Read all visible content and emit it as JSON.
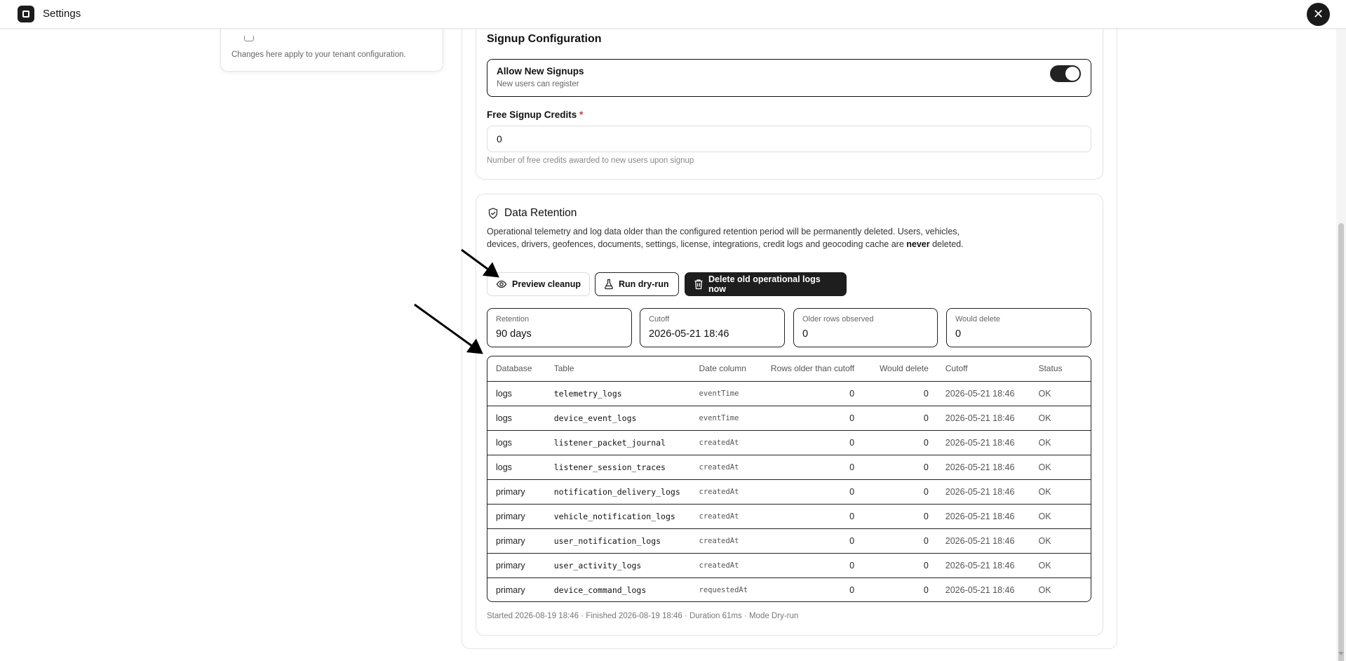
{
  "topbar": {
    "title": "Settings"
  },
  "side_card": {
    "note": "Changes here apply to your tenant configuration."
  },
  "signup": {
    "title": "Signup Configuration",
    "allow_label": "Allow New Signups",
    "allow_sub": "New users can register",
    "allow_enabled": true,
    "credits_label": "Free Signup Credits",
    "credits_required": "*",
    "credits_value": "0",
    "credits_help": "Number of free credits awarded to new users upon signup"
  },
  "retention": {
    "title": "Data Retention",
    "desc_main": "Operational telemetry and log data older than the configured retention period will be permanently deleted. Users, vehicles, devices, drivers, geofences, documents, settings, license, integrations, credit logs and geocoding cache are ",
    "desc_bold": "never",
    "desc_end": " deleted.",
    "buttons": {
      "preview": "Preview cleanup",
      "dryrun": "Run dry-run",
      "delete": "Delete old operational logs now"
    },
    "stats": [
      {
        "label": "Retention",
        "value": "90 days"
      },
      {
        "label": "Cutoff",
        "value": "2026-05-21 18:46"
      },
      {
        "label": "Older rows observed",
        "value": "0"
      },
      {
        "label": "Would delete",
        "value": "0"
      }
    ],
    "table": {
      "headers": [
        "Database",
        "Table",
        "Date column",
        "Rows older than cutoff",
        "Would delete",
        "Cutoff",
        "Status"
      ],
      "rows": [
        [
          "logs",
          "telemetry_logs",
          "eventTime",
          "0",
          "0",
          "2026-05-21 18:46",
          "OK"
        ],
        [
          "logs",
          "device_event_logs",
          "eventTime",
          "0",
          "0",
          "2026-05-21 18:46",
          "OK"
        ],
        [
          "logs",
          "listener_packet_journal",
          "createdAt",
          "0",
          "0",
          "2026-05-21 18:46",
          "OK"
        ],
        [
          "logs",
          "listener_session_traces",
          "createdAt",
          "0",
          "0",
          "2026-05-21 18:46",
          "OK"
        ],
        [
          "primary",
          "notification_delivery_logs",
          "createdAt",
          "0",
          "0",
          "2026-05-21 18:46",
          "OK"
        ],
        [
          "primary",
          "vehicle_notification_logs",
          "createdAt",
          "0",
          "0",
          "2026-05-21 18:46",
          "OK"
        ],
        [
          "primary",
          "user_notification_logs",
          "createdAt",
          "0",
          "0",
          "2026-05-21 18:46",
          "OK"
        ],
        [
          "primary",
          "user_activity_logs",
          "createdAt",
          "0",
          "0",
          "2026-05-21 18:46",
          "OK"
        ],
        [
          "primary",
          "device_command_logs",
          "requestedAt",
          "0",
          "0",
          "2026-05-21 18:46",
          "OK"
        ]
      ]
    },
    "run_summary": "Started 2026-08-19 18:46 · Finished 2026-08-19 18:46 · Duration 61ms · Mode Dry-run"
  },
  "colors": {
    "accent_dark": "#1e1e1e",
    "required": "#e03131"
  },
  "icons": [
    "app-icon",
    "close-icon",
    "shield-icon",
    "eye-icon",
    "flask-icon",
    "trash-icon"
  ]
}
